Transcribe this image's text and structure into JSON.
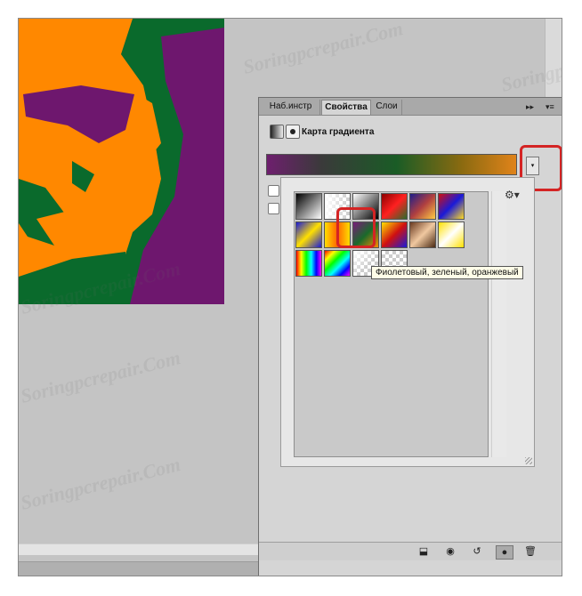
{
  "panel": {
    "tabs": [
      {
        "label": "Наб.инстр",
        "active": false
      },
      {
        "label": "Свойства",
        "active": true
      },
      {
        "label": "Слои",
        "active": false
      }
    ],
    "controls": {
      "collapse": "▸▸",
      "menu": "▾≡"
    },
    "header": {
      "title": "Карта градиента"
    },
    "gradient_bar": {
      "colors": [
        "#6e1f6e",
        "#3a3a3a",
        "#1a5c26",
        "#8a6a10",
        "#e0831a"
      ]
    },
    "dropdown_arrow": "▾",
    "tooltip": "Фиолетовый, зеленый, оранжевый",
    "gear": "⚙▾",
    "bottom_icons": [
      {
        "name": "clip-icon",
        "glyph": "⬓"
      },
      {
        "name": "view-previous-icon",
        "glyph": "◉"
      },
      {
        "name": "reset-icon",
        "glyph": "↺"
      },
      {
        "name": "visibility-icon",
        "glyph": "●"
      },
      {
        "name": "delete-icon",
        "glyph": "🗑"
      }
    ]
  },
  "watermark": "Soringpcrepair.Com",
  "accent": {
    "highlight_red": "#d42424",
    "purple": "#6e1f6e",
    "green": "#0a6a2c",
    "orange": "#ff8800"
  }
}
